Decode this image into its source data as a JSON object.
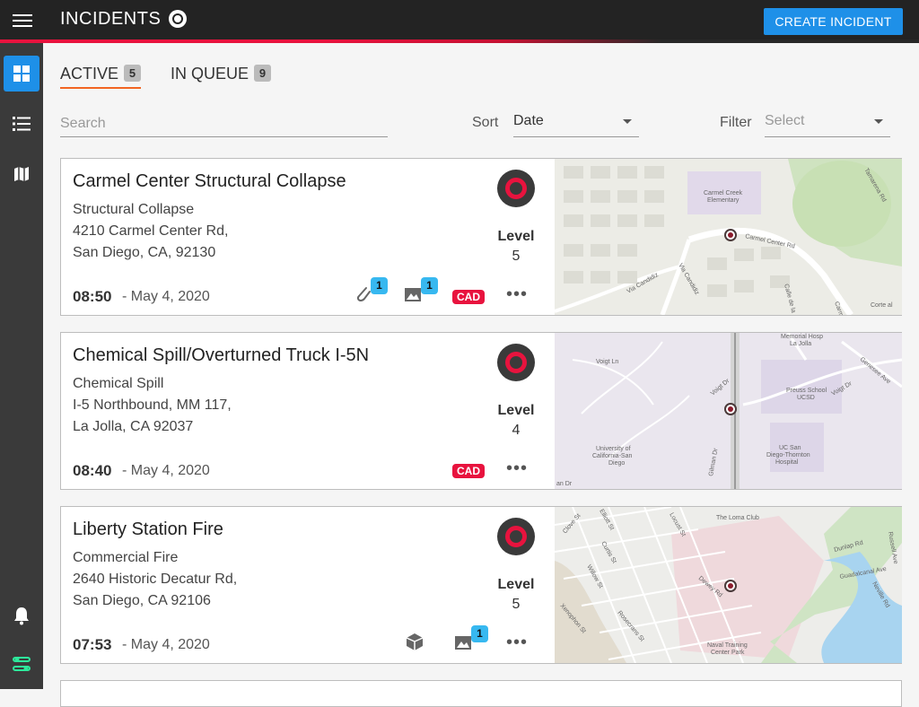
{
  "header": {
    "title": "INCIDENTS",
    "create_label": "CREATE INCIDENT"
  },
  "sidebar": {
    "items": [
      {
        "icon": "dashboard-icon",
        "active": true
      },
      {
        "icon": "list-icon"
      },
      {
        "icon": "map-icon"
      },
      {
        "icon": "bell-icon"
      },
      {
        "icon": "settings-sliders-icon"
      }
    ]
  },
  "tabs": [
    {
      "label": "ACTIVE",
      "count": "5"
    },
    {
      "label": "IN QUEUE",
      "count": "9"
    }
  ],
  "search": {
    "placeholder": "Search"
  },
  "sort": {
    "label": "Sort",
    "value": "Date"
  },
  "filter": {
    "label": "Filter",
    "placeholder": "Select"
  },
  "incidents": [
    {
      "title": "Carmel Center Structural Collapse",
      "type": "Structural Collapse",
      "address1": "4210 Carmel Center Rd,",
      "address2": "San Diego, CA, 92130",
      "time": "08:50",
      "date": "- May 4, 2020",
      "level_label": "Level",
      "level": "5",
      "attachments": "1",
      "images": "1",
      "cad": "CAD",
      "map": {
        "labels": [
          "Carmel Creek",
          "Elementary",
          "Carmel Center Rd",
          "Via Candidiz",
          "Via Candidiz",
          "Calle de la",
          "Corte al",
          "Tamarena Rd",
          "Carm"
        ]
      }
    },
    {
      "title": "Chemical Spill/Overturned Truck I-5N",
      "type": "Chemical Spill",
      "address1": "I-5 Northbound, MM 117,",
      "address2": "La Jolla, CA 92037",
      "time": "08:40",
      "date": "- May 4, 2020",
      "level_label": "Level",
      "level": "4",
      "cad": "CAD",
      "map": {
        "labels": [
          "Memorial Hosp",
          "La Jolla",
          "Voigt Ln",
          "Voigt Dr",
          "Preuss School",
          "UCSD",
          "Voigt Dr",
          "Genesee Ave",
          "University of",
          "California-San",
          "Diego",
          "UC San",
          "Diego-Thornton",
          "Hospital",
          "Gilman Dr",
          "an Dr"
        ]
      }
    },
    {
      "title": "Liberty Station Fire",
      "type": "Commercial Fire",
      "address1": "2640 Historic Decatur Rd,",
      "address2": "San Diego, CA 92106",
      "time": "07:53",
      "date": "- May 4, 2020",
      "level_label": "Level",
      "level": "5",
      "images": "1",
      "map": {
        "labels": [
          "Elliott St",
          "Locust St",
          "The Loma Club",
          "Clove St",
          "Curtis St",
          "Dunlap Rd",
          "Russell Ave",
          "Willow St",
          "Guadalcanal Ave",
          "Dewey Rd",
          "Neville Rd",
          "Xenophon St",
          "Rosecrans St",
          "Naval Training",
          "Center Park"
        ]
      }
    }
  ]
}
